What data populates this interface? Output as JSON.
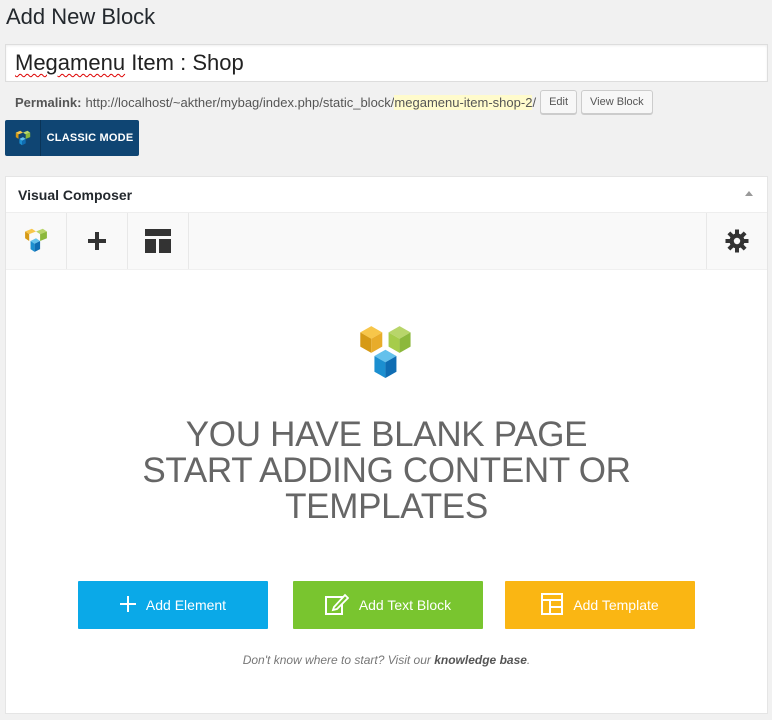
{
  "page": {
    "title": "Add New Block"
  },
  "post_title": {
    "spellcheck_word": "Megamenu",
    "rest": " Item : Shop"
  },
  "permalink": {
    "label": "Permalink:",
    "base_url": "http://localhost/~akther/mybag/index.php/static_block/",
    "slug": "megamenu-item-shop-2",
    "trailing": "/",
    "edit_label": "Edit",
    "view_label": "View Block"
  },
  "classic_mode": {
    "label": "CLASSIC MODE"
  },
  "composer": {
    "title": "Visual Composer",
    "toolbar": {
      "icons": [
        "vc-logo-icon",
        "plus-icon",
        "layout-icon",
        "gear-icon"
      ]
    },
    "empty": {
      "line1": "YOU HAVE BLANK PAGE",
      "line2": "START ADDING CONTENT OR",
      "line3": "TEMPLATES"
    },
    "buttons": {
      "add_element": "Add Element",
      "add_text_block": "Add Text Block",
      "add_template": "Add Template"
    },
    "help": {
      "prefix": "Don't know where to start? Visit our ",
      "link": "knowledge base",
      "suffix": "."
    }
  },
  "colors": {
    "blue": "#0aa9e8",
    "green": "#79c52f",
    "orange": "#fab613",
    "classic": "#0f4573"
  }
}
